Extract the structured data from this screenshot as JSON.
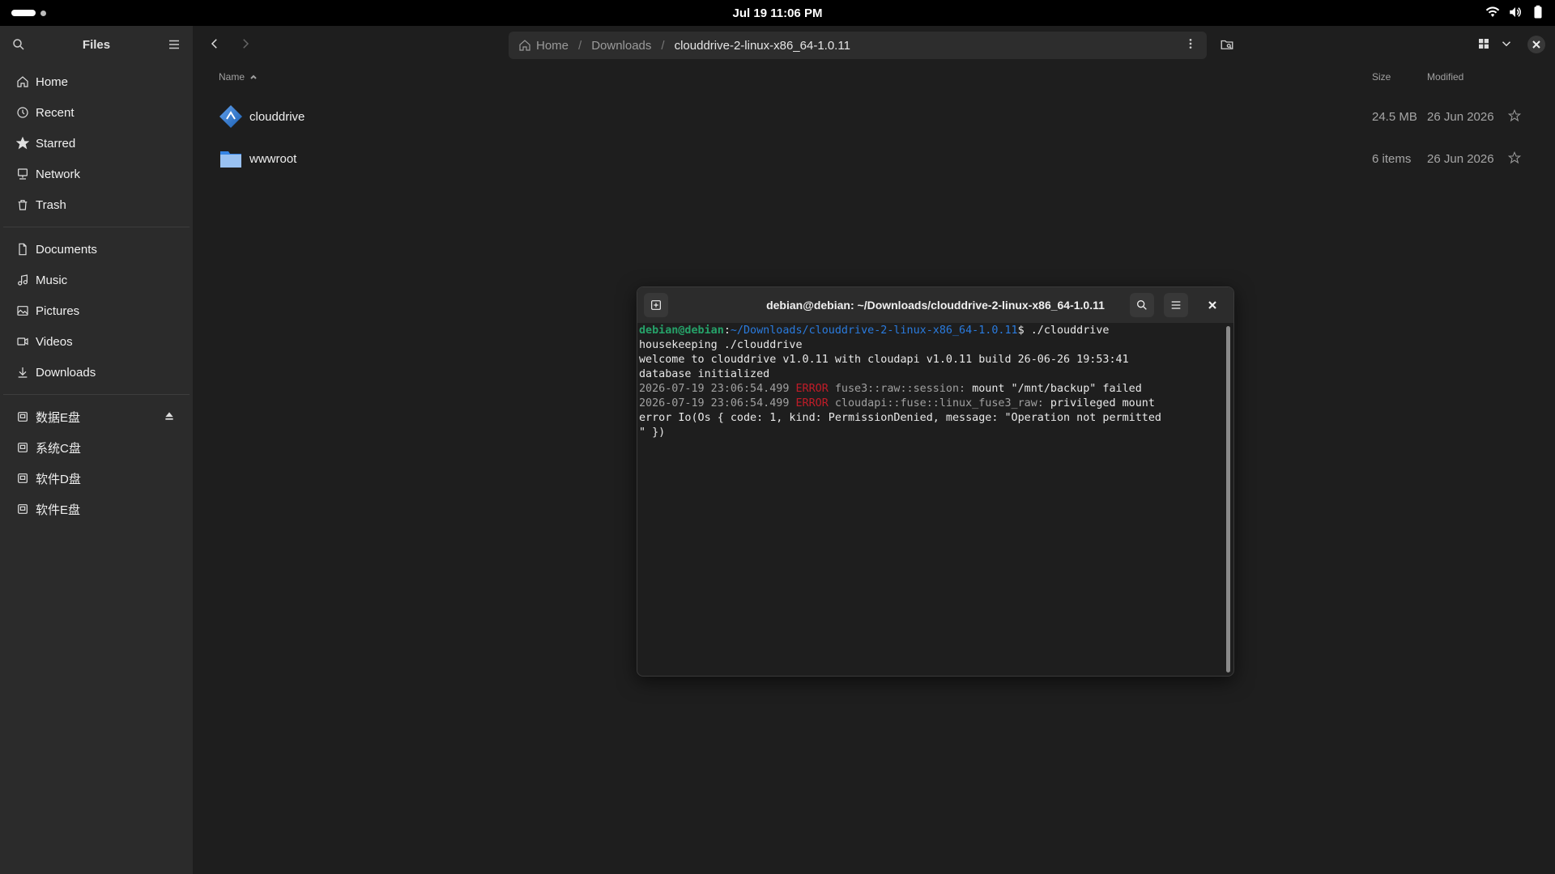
{
  "topbar": {
    "clock": "Jul 19  11:06 PM"
  },
  "sidebar": {
    "title": "Files",
    "places": [
      {
        "label": "Home",
        "icon": "home-icon"
      },
      {
        "label": "Recent",
        "icon": "recent-icon"
      },
      {
        "label": "Starred",
        "icon": "star-icon"
      },
      {
        "label": "Network",
        "icon": "network-icon"
      },
      {
        "label": "Trash",
        "icon": "trash-icon"
      }
    ],
    "bookmarks": [
      {
        "label": "Documents",
        "icon": "document-icon"
      },
      {
        "label": "Music",
        "icon": "music-icon"
      },
      {
        "label": "Pictures",
        "icon": "picture-icon"
      },
      {
        "label": "Videos",
        "icon": "video-icon"
      },
      {
        "label": "Downloads",
        "icon": "download-icon"
      }
    ],
    "drives": [
      {
        "label": "数据E盘",
        "icon": "drive-icon",
        "eject": true
      },
      {
        "label": "系统C盘",
        "icon": "drive-icon"
      },
      {
        "label": "软件D盘",
        "icon": "drive-icon"
      },
      {
        "label": "软件E盘",
        "icon": "drive-icon"
      }
    ]
  },
  "pathbar": {
    "crumbs": [
      "Home",
      "Downloads",
      "clouddrive-2-linux-x86_64-1.0.11"
    ]
  },
  "columns": {
    "name": "Name",
    "size": "Size",
    "modified": "Modified"
  },
  "files": [
    {
      "name": "clouddrive",
      "size": "24.5 MB",
      "modified": "26 Jun 2026",
      "icon": "executable-icon"
    },
    {
      "name": "wwwroot",
      "size": "6 items",
      "modified": "26 Jun 2026",
      "icon": "folder-icon"
    }
  ],
  "terminal": {
    "title": "debian@debian: ~/Downloads/clouddrive-2-linux-x86_64-1.0.11",
    "prompt_user": "debian@debian",
    "prompt_path": "~/Downloads/clouddrive-2-linux-x86_64-1.0.11",
    "command": "$ ./clouddrive",
    "lines": [
      "housekeeping ./clouddrive",
      "welcome to clouddrive v1.0.11 with cloudapi v1.0.11 build 26-06-26 19:53:41",
      "database initialized"
    ],
    "log1_ts": "2026-07-19 23:06:54.499",
    "log1_level": "ERROR",
    "log1_src": "fuse3::raw::session:",
    "log1_msg": "mount \"/mnt/backup\" failed",
    "log2_ts": "2026-07-19 23:06:54.499",
    "log2_level": "ERROR",
    "log2_src": "cloudapi::fuse::linux_fuse3_raw:",
    "log2_msg": "privileged mount",
    "log2_cont1": "error Io(Os { code: 1, kind: PermissionDenied, message: \"Operation not permitted",
    "log2_cont2": "\" })"
  }
}
